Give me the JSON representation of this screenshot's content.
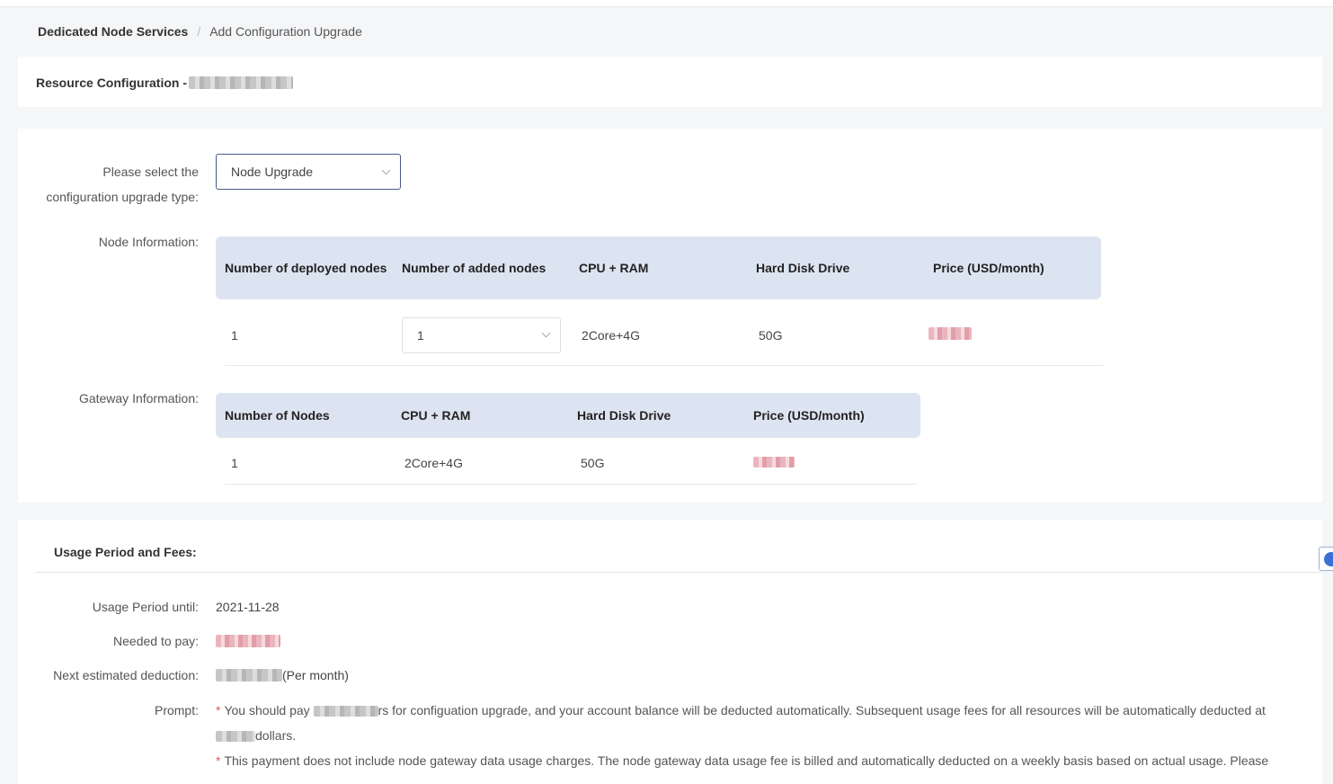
{
  "breadcrumb": {
    "root": "Dedicated Node Services",
    "separator": "/",
    "current": "Add Configuration Upgrade"
  },
  "resource": {
    "title": "Resource Configuration -"
  },
  "config": {
    "type_label_line1": "Please select the",
    "type_label_line2": "configuration upgrade type:",
    "type_value": "Node Upgrade"
  },
  "node_info": {
    "label": "Node Information:",
    "headers": [
      "Number of deployed nodes",
      "Number of added nodes",
      "CPU + RAM",
      "Hard Disk Drive",
      "Price (USD/month)"
    ],
    "row": {
      "deployed": "1",
      "added": "1",
      "cpu_ram": "2Core+4G",
      "disk": "50G"
    }
  },
  "gateway_info": {
    "label": "Gateway Information:",
    "headers": [
      "Number of Nodes",
      "CPU + RAM",
      "Hard Disk Drive",
      "Price (USD/month)"
    ],
    "row": {
      "nodes": "1",
      "cpu_ram": "2Core+4G",
      "disk": "50G"
    }
  },
  "usage": {
    "title": "Usage Period and Fees:",
    "period_label": "Usage Period until:",
    "period_value": "2021-11-28",
    "pay_label": "Needed to pay:",
    "next_label": "Next estimated deduction:",
    "next_suffix": "(Per month)",
    "prompt_label": "Prompt:",
    "prompt1_a": "You should pay",
    "prompt1_b": "rs for configuation upgrade, and your account balance will be deducted automatically. Subsequent usage fees for all resources will be automatically deducted at",
    "prompt1_c": "dollars.",
    "prompt2": "This payment does not include node gateway data usage charges. The node gateway data usage fee is billed and automatically deducted on a weekly basis based on actual usage. Please",
    "star": "*"
  }
}
